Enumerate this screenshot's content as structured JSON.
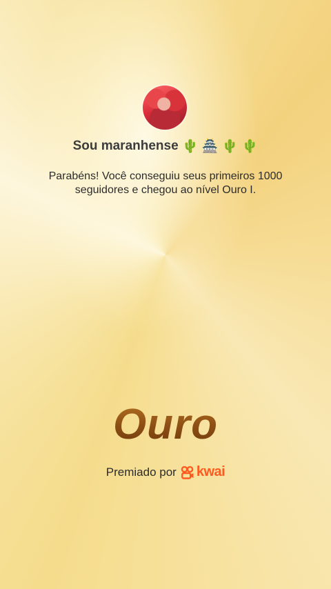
{
  "profile": {
    "name": "Sou maranhense",
    "name_emoji": "🌵 🏯 🌵 🌵"
  },
  "message": "Parabéns! Você conseguiu seus primeiros 1000 seguidores e chegou ao nível Ouro I.",
  "tier": {
    "label": "Ouro"
  },
  "award": {
    "prefix": "Premiado por",
    "brand": "kwai",
    "brand_color": "#ff5a1f"
  }
}
